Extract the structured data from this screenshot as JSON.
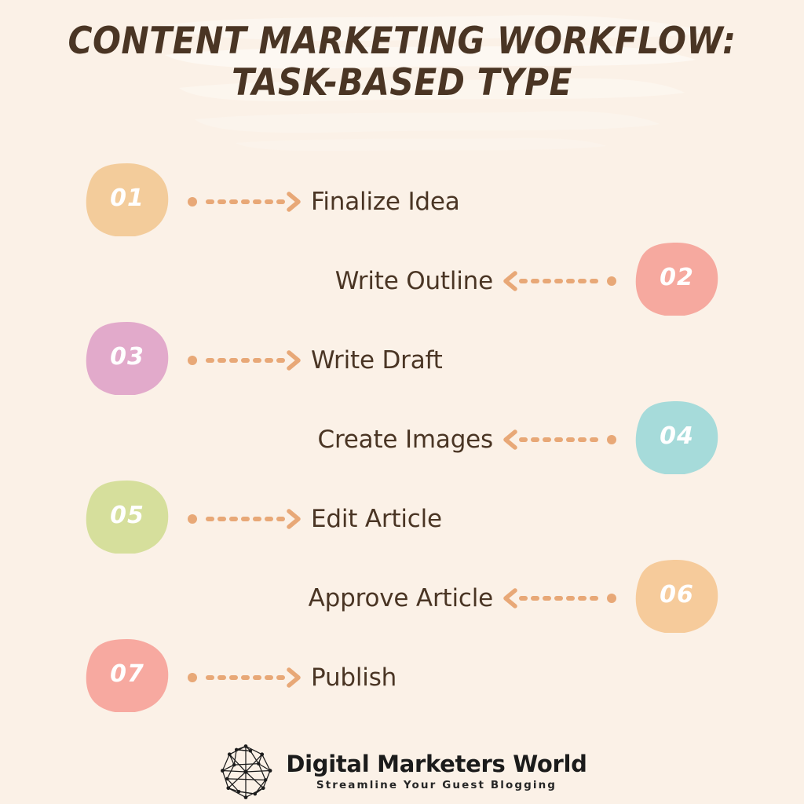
{
  "theme": {
    "background": "#FBF1E7",
    "title_color": "#4A3524",
    "label_color": "#4A3524",
    "arrow_color": "#E8A877",
    "number_color": "#FFFFFF",
    "brush_color": "#FDF8F1"
  },
  "title": {
    "line1": "CONTENT MARKETING WORKFLOW:",
    "line2": "TASK-BASED TYPE"
  },
  "steps": [
    {
      "number": "01",
      "label": "Finalize Idea",
      "side": "left",
      "color": "#F3CC9B",
      "direction": "right"
    },
    {
      "number": "02",
      "label": "Write Outline",
      "side": "right",
      "color": "#F6A99F",
      "direction": "left"
    },
    {
      "number": "03",
      "label": "Write Draft",
      "side": "left",
      "color": "#E2AACB",
      "direction": "right"
    },
    {
      "number": "04",
      "label": "Create Images",
      "side": "right",
      "color": "#A6DBDA",
      "direction": "left"
    },
    {
      "number": "05",
      "label": "Edit Article",
      "side": "left",
      "color": "#D6DF9C",
      "direction": "right"
    },
    {
      "number": "06",
      "label": "Approve Article",
      "side": "right",
      "color": "#F6CB9B",
      "direction": "left"
    },
    {
      "number": "07",
      "label": "Publish",
      "side": "left",
      "color": "#F7A9A0",
      "direction": "right"
    }
  ],
  "footer": {
    "logo_icon": "network-globe-icon",
    "brand_name": "Digital Marketers World",
    "tagline": "Streamline Your Guest Blogging"
  }
}
